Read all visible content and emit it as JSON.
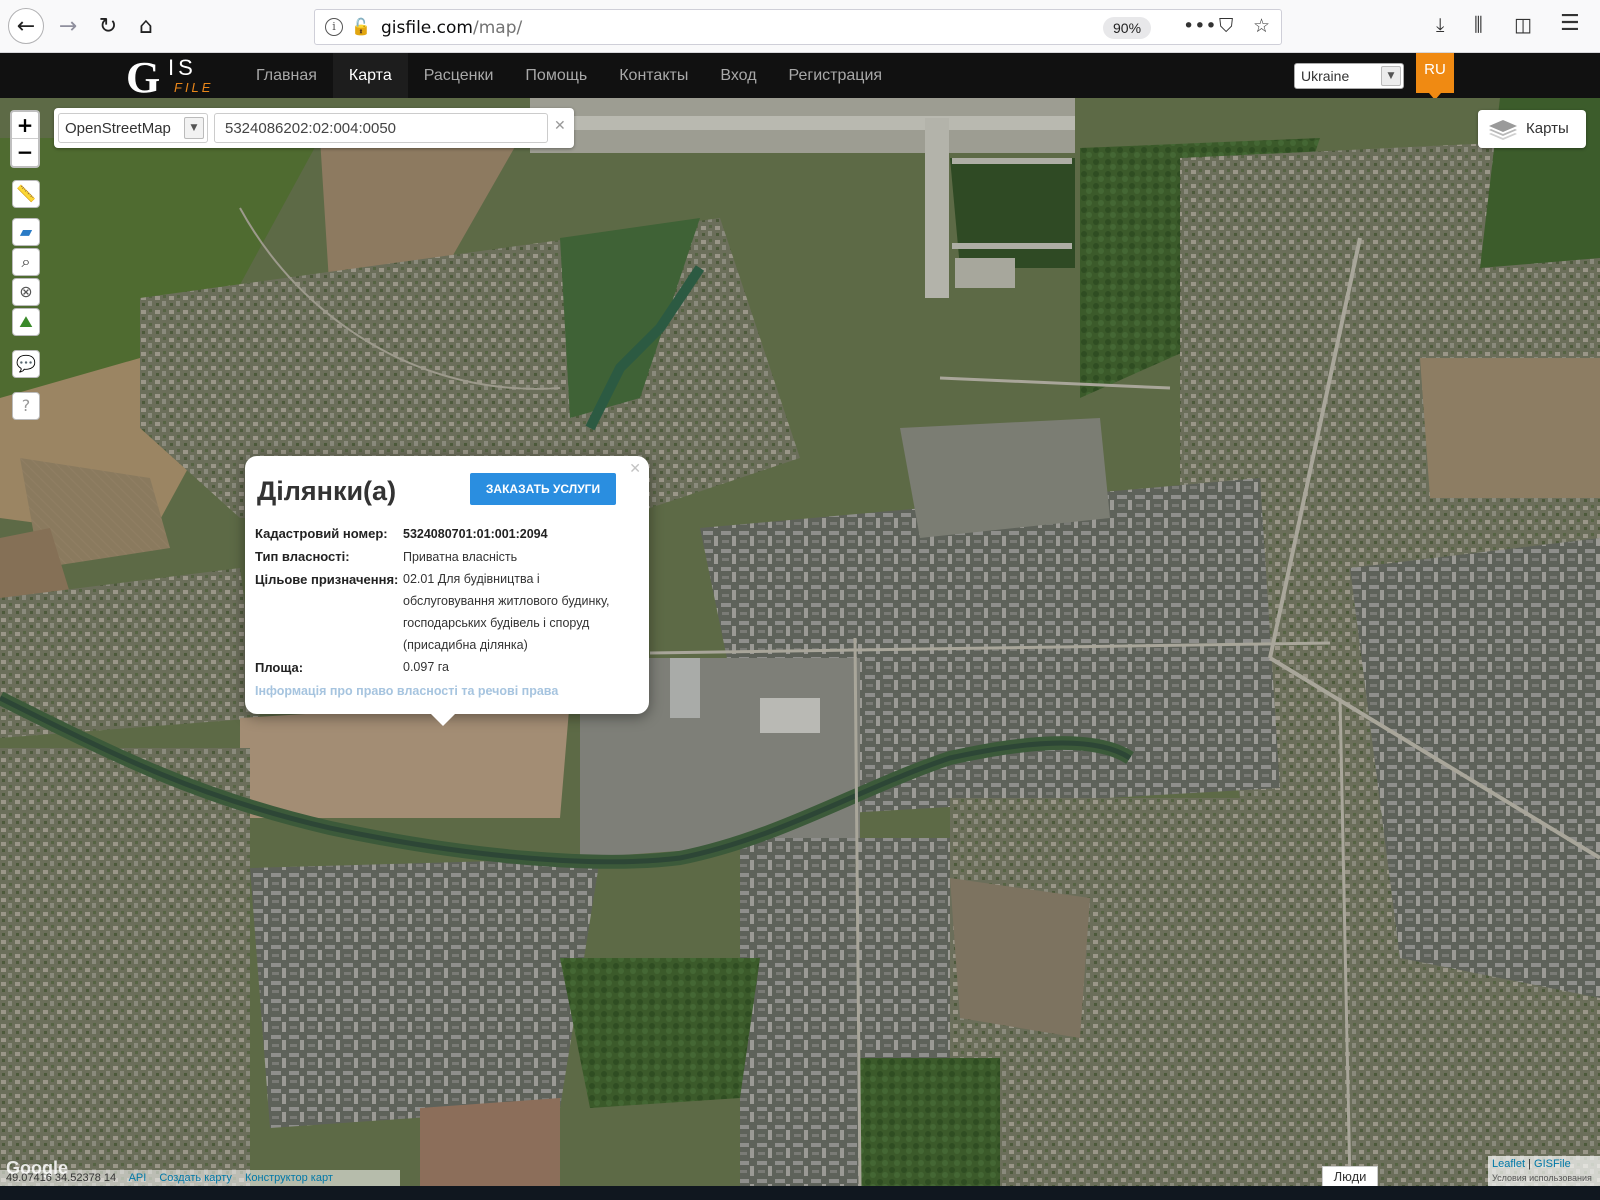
{
  "browser": {
    "url_host": "gisfile.com",
    "url_path": "/map/",
    "zoom": "90%"
  },
  "header": {
    "logo_main": "G",
    "logo_is": "IS",
    "logo_file": "FILE",
    "nav": [
      {
        "label": "Главная",
        "active": false
      },
      {
        "label": "Карта",
        "active": true
      },
      {
        "label": "Расценки",
        "active": false
      },
      {
        "label": "Помощь",
        "active": false
      },
      {
        "label": "Контакты",
        "active": false
      },
      {
        "label": "Вход",
        "active": false
      },
      {
        "label": "Регистрация",
        "active": false
      }
    ],
    "country": "Ukraine",
    "language": "RU"
  },
  "map": {
    "basemap": "OpenStreetMap",
    "search_value": "5324086202:02:004:0050",
    "zoom_in": "+",
    "zoom_out": "−",
    "layers_label": "Карты",
    "tools": [
      "ruler-icon",
      "layer-icon",
      "search-icon",
      "close-icon",
      "landscape-icon",
      "comment-icon",
      "help-icon"
    ],
    "popup": {
      "title": "Ділянки(а)",
      "button": "ЗАКАЗАТЬ УСЛУГИ",
      "cadastral_label": "Кадастровий номер:",
      "cadastral_value": "5324080701:01:001:2094",
      "ownership_label": "Тип власності:",
      "ownership_value": "Приватна власність",
      "purpose_label": "Цільове призначення:",
      "purpose_value": "02.01 Для будівництва і обслуговування житлового будинку, господарських будівель і споруд (присадибна ділянка)",
      "area_label": "Площа:",
      "area_value": "0.097 га",
      "rights_link": "Інформація про право власності та речові права"
    },
    "bottom": {
      "coordinates": "49.07416 34.52378 14",
      "api": "API",
      "create_map": "Создать карту",
      "constructor": "Конструктор карт",
      "google": "Google",
      "people": "Люди",
      "attribution_leaflet": "Leaflet",
      "attribution_gisfile": "GISFile",
      "attribution_sub": "Условия использования"
    }
  }
}
